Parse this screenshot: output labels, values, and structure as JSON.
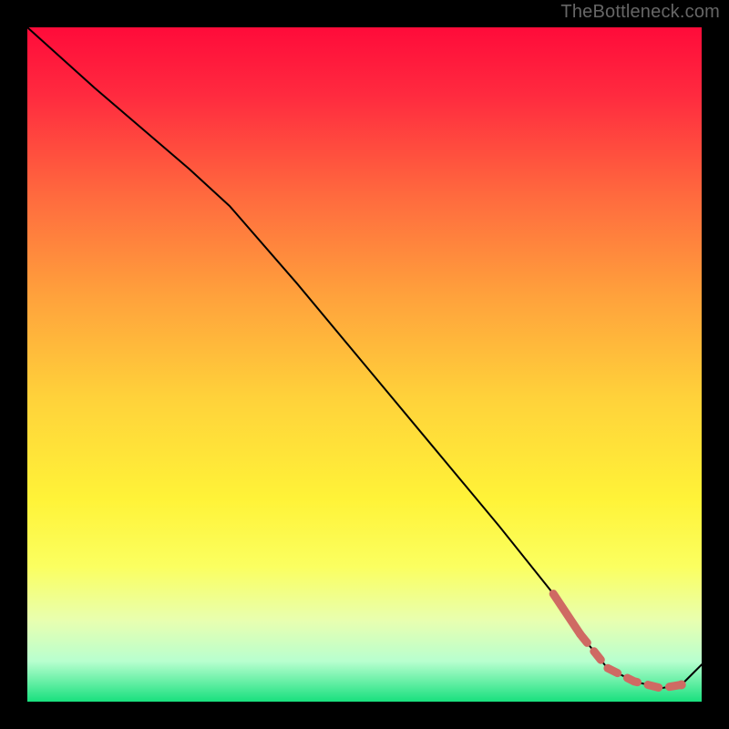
{
  "watermark": "TheBottleneck.com",
  "colors": {
    "gradient_stops": [
      {
        "offset": 0.0,
        "color": "#ff0b3a"
      },
      {
        "offset": 0.1,
        "color": "#ff2a3f"
      },
      {
        "offset": 0.25,
        "color": "#ff6a3e"
      },
      {
        "offset": 0.4,
        "color": "#ffa23c"
      },
      {
        "offset": 0.55,
        "color": "#ffd23a"
      },
      {
        "offset": 0.7,
        "color": "#fff338"
      },
      {
        "offset": 0.8,
        "color": "#fbff60"
      },
      {
        "offset": 0.88,
        "color": "#e8ffb0"
      },
      {
        "offset": 0.94,
        "color": "#b8ffcf"
      },
      {
        "offset": 1.0,
        "color": "#18e07e"
      }
    ],
    "line_main": "#000000",
    "line_accent": "#cf6a63",
    "line_accent_end_dot": "#cf6a63"
  },
  "chart_data": {
    "type": "line",
    "title": "",
    "xlabel": "",
    "ylabel": "",
    "xlim": [
      0,
      100
    ],
    "ylim": [
      0,
      100
    ],
    "grid": false,
    "legend": false,
    "series": [
      {
        "name": "curve",
        "style": "solid-thin-black",
        "x": [
          0,
          10,
          24,
          30,
          40,
          50,
          60,
          70,
          78,
          82,
          86,
          90,
          94,
          97,
          100
        ],
        "y": [
          100,
          91,
          79,
          73.5,
          62,
          50,
          38,
          26,
          16,
          10,
          5,
          3,
          2,
          2.5,
          5.5
        ]
      },
      {
        "name": "accent-tail-solid",
        "style": "solid-thick-accent",
        "x": [
          78,
          82
        ],
        "y": [
          16,
          10
        ]
      },
      {
        "name": "accent-tail-dashed",
        "style": "dashed-thick-accent",
        "x": [
          82,
          86,
          90,
          94,
          97
        ],
        "y": [
          10,
          5,
          3,
          2,
          2.5
        ]
      },
      {
        "name": "accent-end-dot",
        "style": "dot-accent",
        "x": [
          97
        ],
        "y": [
          2.5
        ]
      }
    ],
    "annotations": []
  }
}
